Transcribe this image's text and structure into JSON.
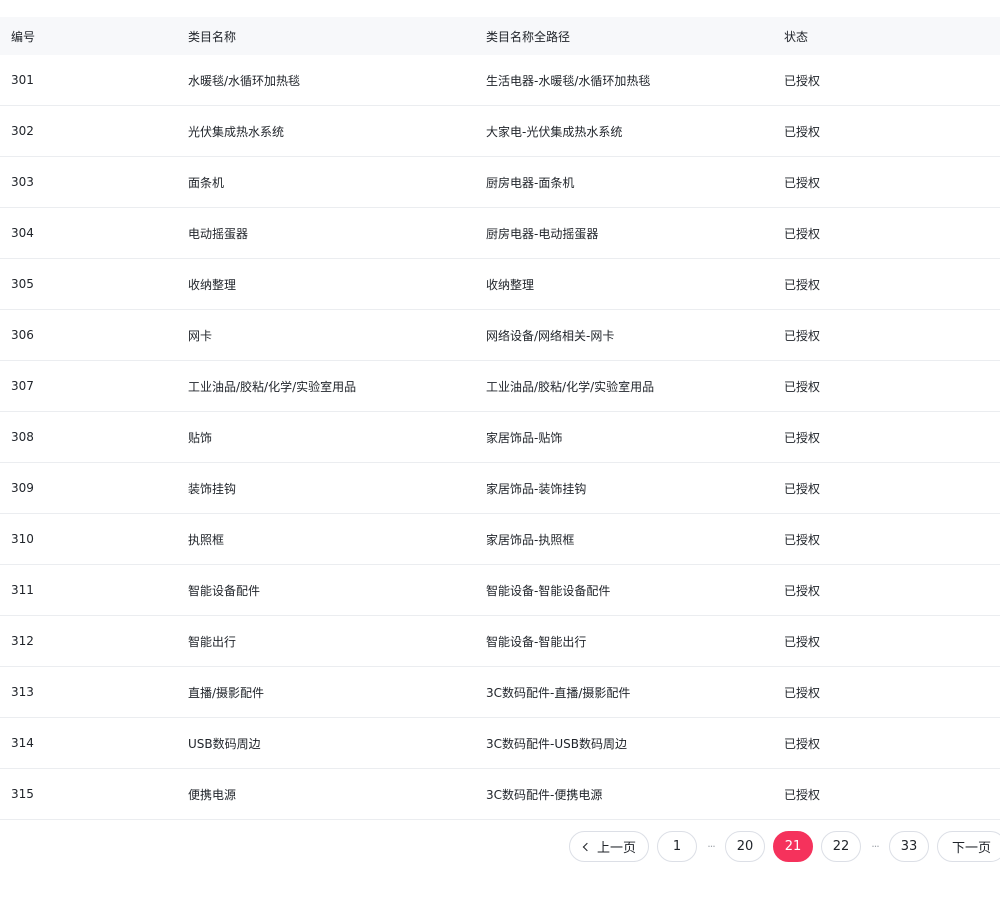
{
  "table": {
    "columns": {
      "id": "编号",
      "name": "类目名称",
      "path": "类目名称全路径",
      "status": "状态"
    },
    "rows": [
      {
        "id": "301",
        "name": "水暖毯/水循环加热毯",
        "path": "生活电器-水暖毯/水循环加热毯",
        "status": "已授权"
      },
      {
        "id": "302",
        "name": "光伏集成热水系统",
        "path": "大家电-光伏集成热水系统",
        "status": "已授权"
      },
      {
        "id": "303",
        "name": "面条机",
        "path": "厨房电器-面条机",
        "status": "已授权"
      },
      {
        "id": "304",
        "name": "电动摇蛋器",
        "path": "厨房电器-电动摇蛋器",
        "status": "已授权"
      },
      {
        "id": "305",
        "name": "收纳整理",
        "path": "收纳整理",
        "status": "已授权"
      },
      {
        "id": "306",
        "name": "网卡",
        "path": "网络设备/网络相关-网卡",
        "status": "已授权"
      },
      {
        "id": "307",
        "name": "工业油品/胶粘/化学/实验室用品",
        "path": "工业油品/胶粘/化学/实验室用品",
        "status": "已授权"
      },
      {
        "id": "308",
        "name": "贴饰",
        "path": "家居饰品-贴饰",
        "status": "已授权"
      },
      {
        "id": "309",
        "name": "装饰挂钩",
        "path": "家居饰品-装饰挂钩",
        "status": "已授权"
      },
      {
        "id": "310",
        "name": "执照框",
        "path": "家居饰品-执照框",
        "status": "已授权"
      },
      {
        "id": "311",
        "name": "智能设备配件",
        "path": "智能设备-智能设备配件",
        "status": "已授权"
      },
      {
        "id": "312",
        "name": "智能出行",
        "path": "智能设备-智能出行",
        "status": "已授权"
      },
      {
        "id": "313",
        "name": "直播/摄影配件",
        "path": "3C数码配件-直播/摄影配件",
        "status": "已授权"
      },
      {
        "id": "314",
        "name": "USB数码周边",
        "path": "3C数码配件-USB数码周边",
        "status": "已授权"
      },
      {
        "id": "315",
        "name": "便携电源",
        "path": "3C数码配件-便携电源",
        "status": "已授权"
      }
    ]
  },
  "pagination": {
    "prev_label": "上一页",
    "next_label": "下一页",
    "ellipsis": "···",
    "pages": [
      "1",
      "20",
      "21",
      "22",
      "33"
    ],
    "current": "21",
    "accent_color": "#f5325c"
  }
}
